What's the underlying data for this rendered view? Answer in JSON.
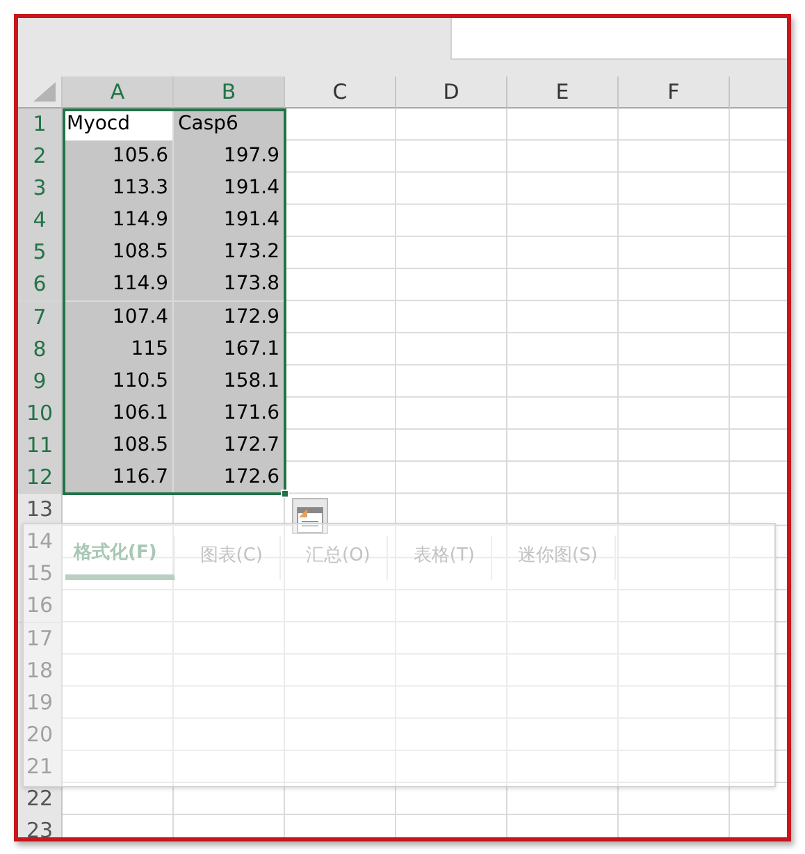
{
  "columns": [
    {
      "label": "A",
      "selected": true
    },
    {
      "label": "B",
      "selected": true
    },
    {
      "label": "C",
      "selected": false
    },
    {
      "label": "D",
      "selected": false
    },
    {
      "label": "E",
      "selected": false
    },
    {
      "label": "F",
      "selected": false
    }
  ],
  "rows": [
    {
      "label": "1",
      "selected": true,
      "cells": [
        {
          "text": "Myocd",
          "kind": "text",
          "active": true
        },
        {
          "text": "Casp6",
          "kind": "text",
          "active": false
        }
      ]
    },
    {
      "label": "2",
      "selected": true,
      "cells": [
        {
          "text": "105.6",
          "kind": "number",
          "active": false
        },
        {
          "text": "197.9",
          "kind": "number",
          "active": false
        }
      ]
    },
    {
      "label": "3",
      "selected": true,
      "cells": [
        {
          "text": "113.3",
          "kind": "number",
          "active": false
        },
        {
          "text": "191.4",
          "kind": "number",
          "active": false
        }
      ]
    },
    {
      "label": "4",
      "selected": true,
      "cells": [
        {
          "text": "114.9",
          "kind": "number",
          "active": false
        },
        {
          "text": "191.4",
          "kind": "number",
          "active": false
        }
      ]
    },
    {
      "label": "5",
      "selected": true,
      "cells": [
        {
          "text": "108.5",
          "kind": "number",
          "active": false
        },
        {
          "text": "173.2",
          "kind": "number",
          "active": false
        }
      ]
    },
    {
      "label": "6",
      "selected": true,
      "cells": [
        {
          "text": "114.9",
          "kind": "number",
          "active": false
        },
        {
          "text": "173.8",
          "kind": "number",
          "active": false
        }
      ]
    },
    {
      "label": "7",
      "selected": true,
      "cells": [
        {
          "text": "107.4",
          "kind": "number",
          "active": false
        },
        {
          "text": "172.9",
          "kind": "number",
          "active": false
        }
      ]
    },
    {
      "label": "8",
      "selected": true,
      "cells": [
        {
          "text": "115",
          "kind": "number",
          "active": false
        },
        {
          "text": "167.1",
          "kind": "number",
          "active": false
        }
      ]
    },
    {
      "label": "9",
      "selected": true,
      "cells": [
        {
          "text": "110.5",
          "kind": "number",
          "active": false
        },
        {
          "text": "158.1",
          "kind": "number",
          "active": false
        }
      ]
    },
    {
      "label": "10",
      "selected": true,
      "cells": [
        {
          "text": "106.1",
          "kind": "number",
          "active": false
        },
        {
          "text": "171.6",
          "kind": "number",
          "active": false
        }
      ]
    },
    {
      "label": "11",
      "selected": true,
      "cells": [
        {
          "text": "108.5",
          "kind": "number",
          "active": false
        },
        {
          "text": "172.7",
          "kind": "number",
          "active": false
        }
      ]
    },
    {
      "label": "12",
      "selected": true,
      "cells": [
        {
          "text": "116.7",
          "kind": "number",
          "active": false
        },
        {
          "text": "172.6",
          "kind": "number",
          "active": false
        }
      ]
    },
    {
      "label": "13",
      "selected": false
    },
    {
      "label": "14",
      "selected": false
    },
    {
      "label": "15",
      "selected": false
    },
    {
      "label": "16",
      "selected": false
    },
    {
      "label": "17",
      "selected": false
    },
    {
      "label": "18",
      "selected": false
    },
    {
      "label": "19",
      "selected": false
    },
    {
      "label": "20",
      "selected": false
    },
    {
      "label": "21",
      "selected": false
    },
    {
      "label": "22",
      "selected": false
    },
    {
      "label": "23",
      "selected": false
    }
  ],
  "quick_analysis": {
    "tabs": [
      {
        "label": "格式化(F)",
        "selected": true
      },
      {
        "label": "图表(C)",
        "selected": false
      },
      {
        "label": "汇总(O)",
        "selected": false
      },
      {
        "label": "表格(T)",
        "selected": false
      },
      {
        "label": "迷你图(S)",
        "selected": false
      }
    ]
  }
}
